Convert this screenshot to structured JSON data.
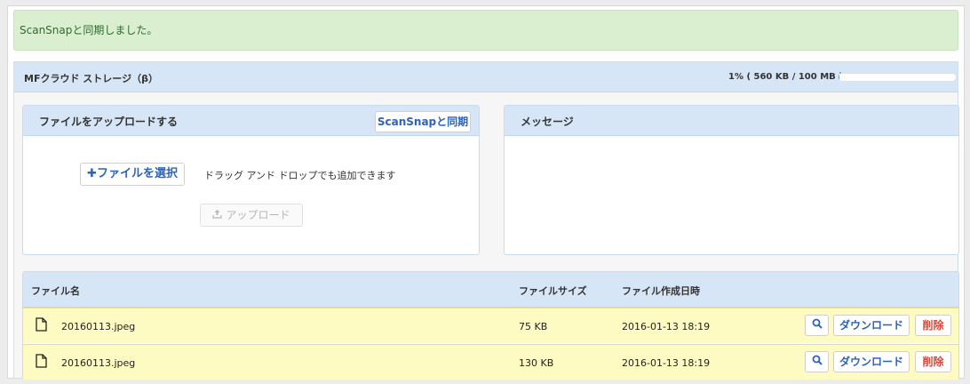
{
  "alert": {
    "message": "ScanSnapと同期しました。"
  },
  "storage": {
    "title": "MFクラウド ストレージ（β）",
    "quota_text": "1% ( 560 KB / 100 MB )",
    "quota_percent": 1,
    "accent_color": "#4a8fd6"
  },
  "upload": {
    "title": "ファイルをアップロードする",
    "scansnap_button": "ScanSnapと同期",
    "select_button": "✚ファイルを選択",
    "dnd_hint": "ドラッグ アンド ドロップでも追加できます",
    "upload_button": "アップロード",
    "upload_icon": "upload-icon"
  },
  "messages": {
    "title": "メッセージ"
  },
  "table": {
    "columns": {
      "name": "ファイル名",
      "size": "ファイルサイズ",
      "date": "ファイル作成日時"
    },
    "rows": [
      {
        "name": "20160113.jpeg",
        "size": "75 KB",
        "date": "2016-01-13 18:19"
      },
      {
        "name": "20160113.jpeg",
        "size": "130 KB",
        "date": "2016-01-13 18:19"
      }
    ],
    "actions": {
      "download": "ダウンロード",
      "delete": "削除",
      "search_icon": "search-icon"
    }
  }
}
